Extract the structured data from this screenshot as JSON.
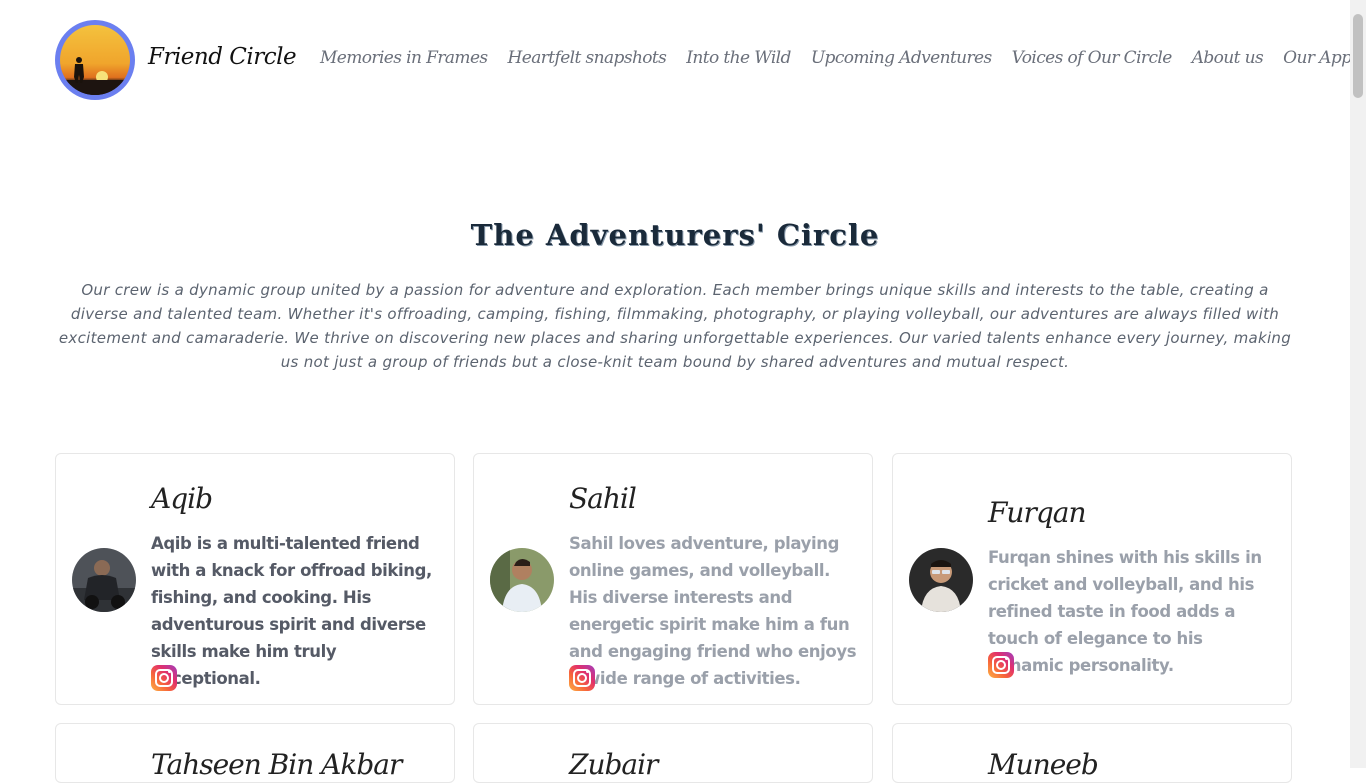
{
  "brand": {
    "name": "Friend Circle"
  },
  "nav": {
    "items": [
      "Memories in Frames",
      "Heartfelt snapshots",
      "Into the Wild",
      "Upcoming Adventures",
      "Voices of Our Circle",
      "About us",
      "Our App"
    ]
  },
  "section": {
    "title": "The Adventurers' Circle",
    "description": "Our crew is a dynamic group united by a passion for adventure and exploration. Each member brings unique skills and interests to the table, creating a diverse and talented team. Whether it's offroading, camping, fishing, filmmaking, photography, or playing volleyball, our adventures are always filled with excitement and camaraderie. We thrive on discovering new places and sharing unforgettable experiences. Our varied talents enhance every journey, making us not just a group of friends but a close-knit team bound by shared adventures and mutual respect."
  },
  "members": [
    {
      "name": "Aqib",
      "bio": "Aqib is a multi-talented friend with a knack for offroad biking, fishing, and cooking. His adventurous spirit and diverse skills make him truly exceptional.",
      "text_color": "#555a66",
      "social": "instagram-icon"
    },
    {
      "name": "Sahil",
      "bio": "Sahil loves adventure, playing online games, and volleyball. His diverse interests and energetic spirit make him a fun and engaging friend who enjoys a wide range of activities.",
      "text_color": "#9aa0aa",
      "social": "instagram-icon"
    },
    {
      "name": "Furqan",
      "bio": "Furqan shines with his skills in cricket and volleyball, and his refined taste in food adds a touch of elegance to his dynamic personality.",
      "text_color": "#9aa0aa",
      "social": "instagram-icon"
    },
    {
      "name": "Tahseen Bin Akbar"
    },
    {
      "name": "Zubair"
    },
    {
      "name": "Muneeb"
    }
  ],
  "colors": {
    "logo_ring": "#6b7ff0",
    "nav_text": "#6a6f7a",
    "title": "#1a2a3a"
  }
}
